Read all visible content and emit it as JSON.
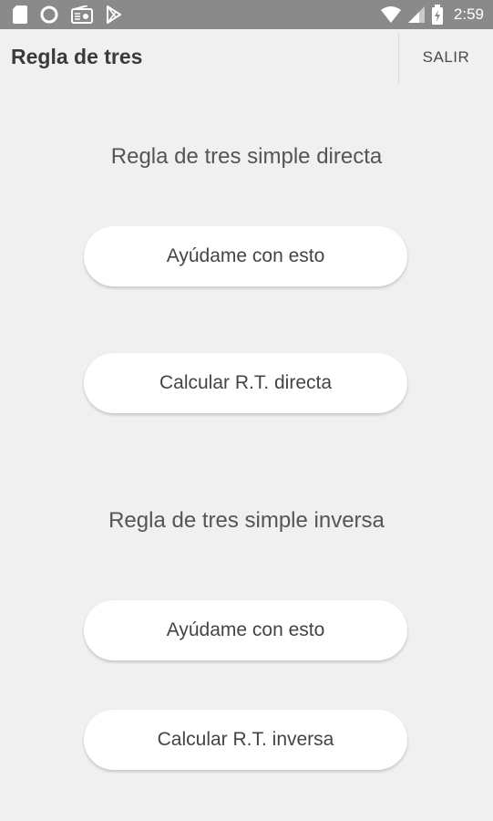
{
  "status_bar": {
    "time": "2:59",
    "left_icons": [
      "sd-card-icon",
      "circle-icon",
      "radio-icon",
      "play-store-icon"
    ],
    "right_icons": [
      "wifi-icon",
      "signal-icon",
      "battery-icon"
    ]
  },
  "app_bar": {
    "title": "Regla de tres",
    "exit_label": "SALIR"
  },
  "sections": [
    {
      "heading": "Regla de tres simple directa",
      "help_label": "Ayúdame con esto",
      "calc_label": "Calcular R.T. directa"
    },
    {
      "heading": "Regla de tres simple inversa",
      "help_label": "Ayúdame con esto",
      "calc_label": "Calcular R.T. inversa"
    }
  ],
  "colors": {
    "background": "#f0f0f0",
    "status_bar": "#8a8a8a",
    "button": "#ffffff",
    "text": "#444444"
  }
}
